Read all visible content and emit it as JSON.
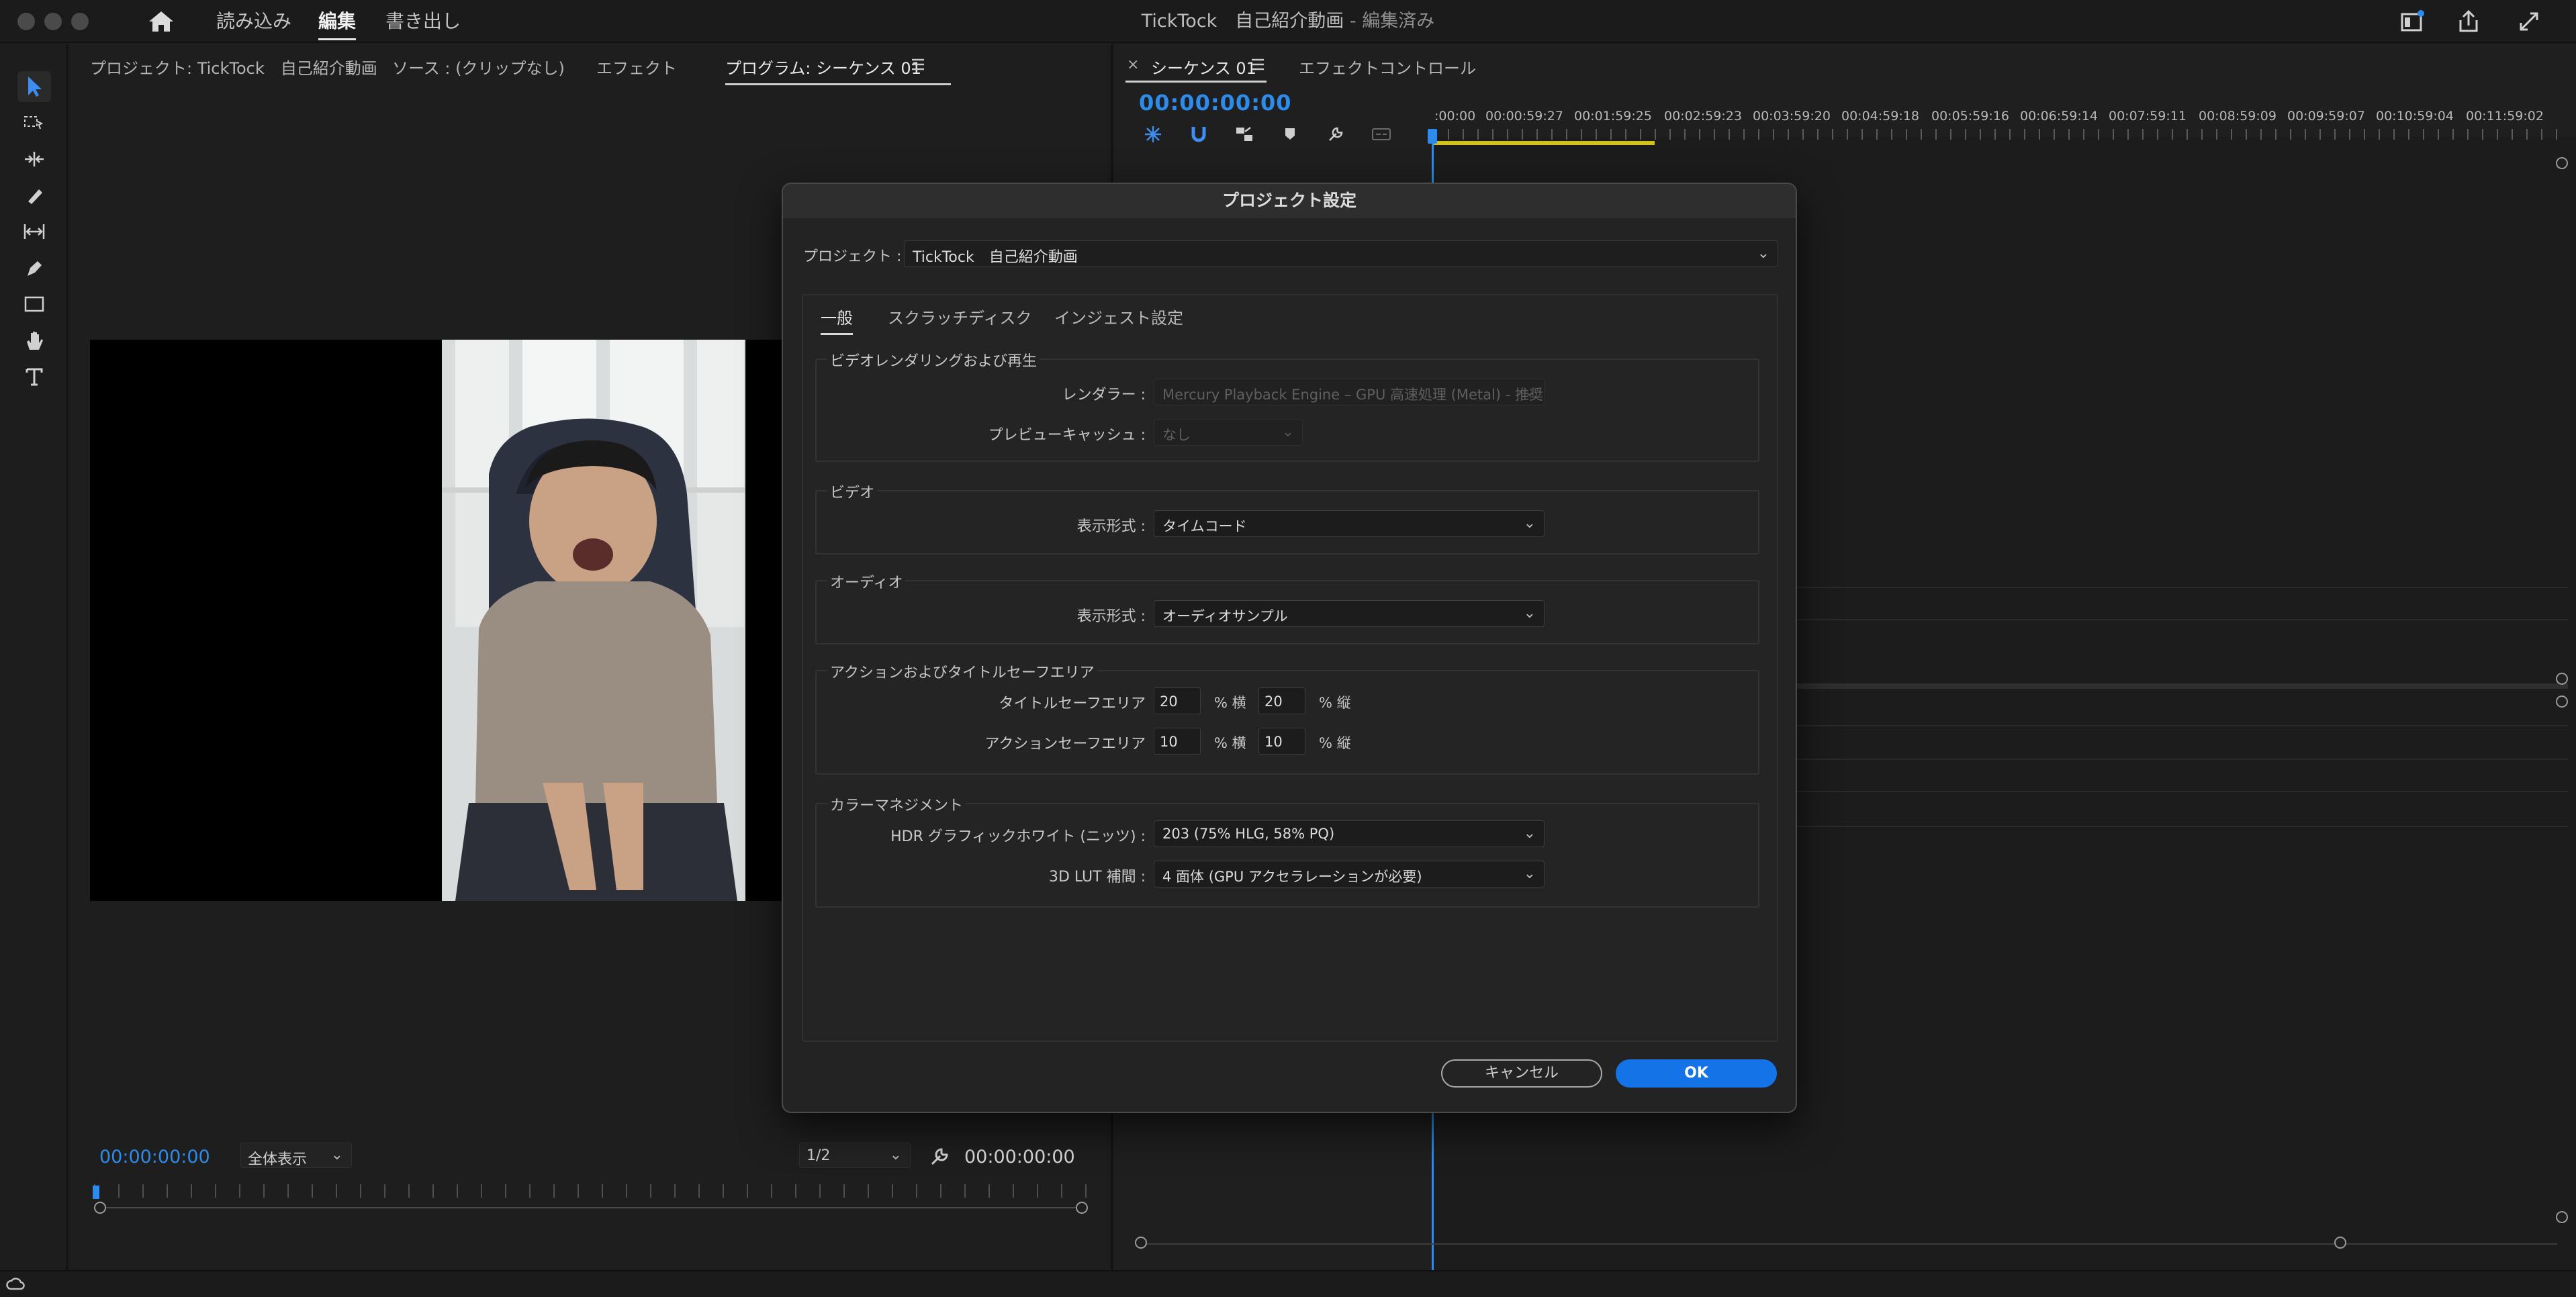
{
  "topbar": {
    "nav": [
      "読み込み",
      "編集",
      "書き出し"
    ],
    "active_nav": "編集",
    "title_main": "TickTock　自己紹介動画",
    "title_status": " - 編集済み"
  },
  "monitor": {
    "tabs": [
      "プロジェクト: TickTock　自己紹介動画",
      "ソース : (クリップなし)",
      "エフェクト",
      "プログラム: シーケンス 01"
    ],
    "active_tab": "プログラム: シーケンス 01",
    "timecode_left": "00:00:00:00",
    "zoom": "全体表示",
    "resolution": "1/2",
    "timecode_right": "00:00:00:00"
  },
  "timeline": {
    "tabs": [
      "シーケンス 01",
      "エフェクトコントロール"
    ],
    "timecode": "00:00:00:00",
    "ruler": [
      ":00:00",
      "00:00:59:27",
      "00:01:59:25",
      "00:02:59:23",
      "00:03:59:20",
      "00:04:59:18",
      "00:05:59:16",
      "00:06:59:14",
      "00:07:59:11",
      "00:08:59:09",
      "00:09:59:07",
      "00:10:59:04",
      "00:11:59:02"
    ]
  },
  "dialog": {
    "title": "プロジェクト設定",
    "project_label": "プロジェクト :",
    "project_value": "TickTock　自己紹介動画",
    "tabs": [
      "一般",
      "スクラッチディスク",
      "インジェスト設定"
    ],
    "active_tab": "一般",
    "render_group": {
      "title": "ビデオレンダリングおよび再生",
      "renderer_label": "レンダラー :",
      "renderer_value": "Mercury Playback Engine – GPU 高速処理 (Metal) - 推奨",
      "preview_label": "プレビューキャッシュ :",
      "preview_value": "なし"
    },
    "video_group": {
      "title": "ビデオ",
      "format_label": "表示形式 :",
      "format_value": "タイムコード"
    },
    "audio_group": {
      "title": "オーディオ",
      "format_label": "表示形式 :",
      "format_value": "オーディオサンプル"
    },
    "safe_group": {
      "title": "アクションおよびタイトルセーフエリア",
      "title_safe_label": "タイトルセーフエリア",
      "title_h": "20",
      "title_v": "20",
      "action_safe_label": "アクションセーフエリア",
      "action_h": "10",
      "action_v": "10",
      "unit_h": "% 横",
      "unit_v": "% 縦"
    },
    "color_group": {
      "title": "カラーマネジメント",
      "hdr_label": "HDR グラフィックホワイト (ニッツ) :",
      "hdr_value": "203 (75% HLG, 58% PQ)",
      "lut_label": "3D LUT 補間 :",
      "lut_value": "4 面体 (GPU アクセラレーションが必要)"
    },
    "cancel_label": "キャンセル",
    "ok_label": "OK"
  },
  "colors": {
    "accent_blue": "#2d8ceb",
    "ok_button": "#1473e6",
    "work_area": "#d3c11b"
  }
}
